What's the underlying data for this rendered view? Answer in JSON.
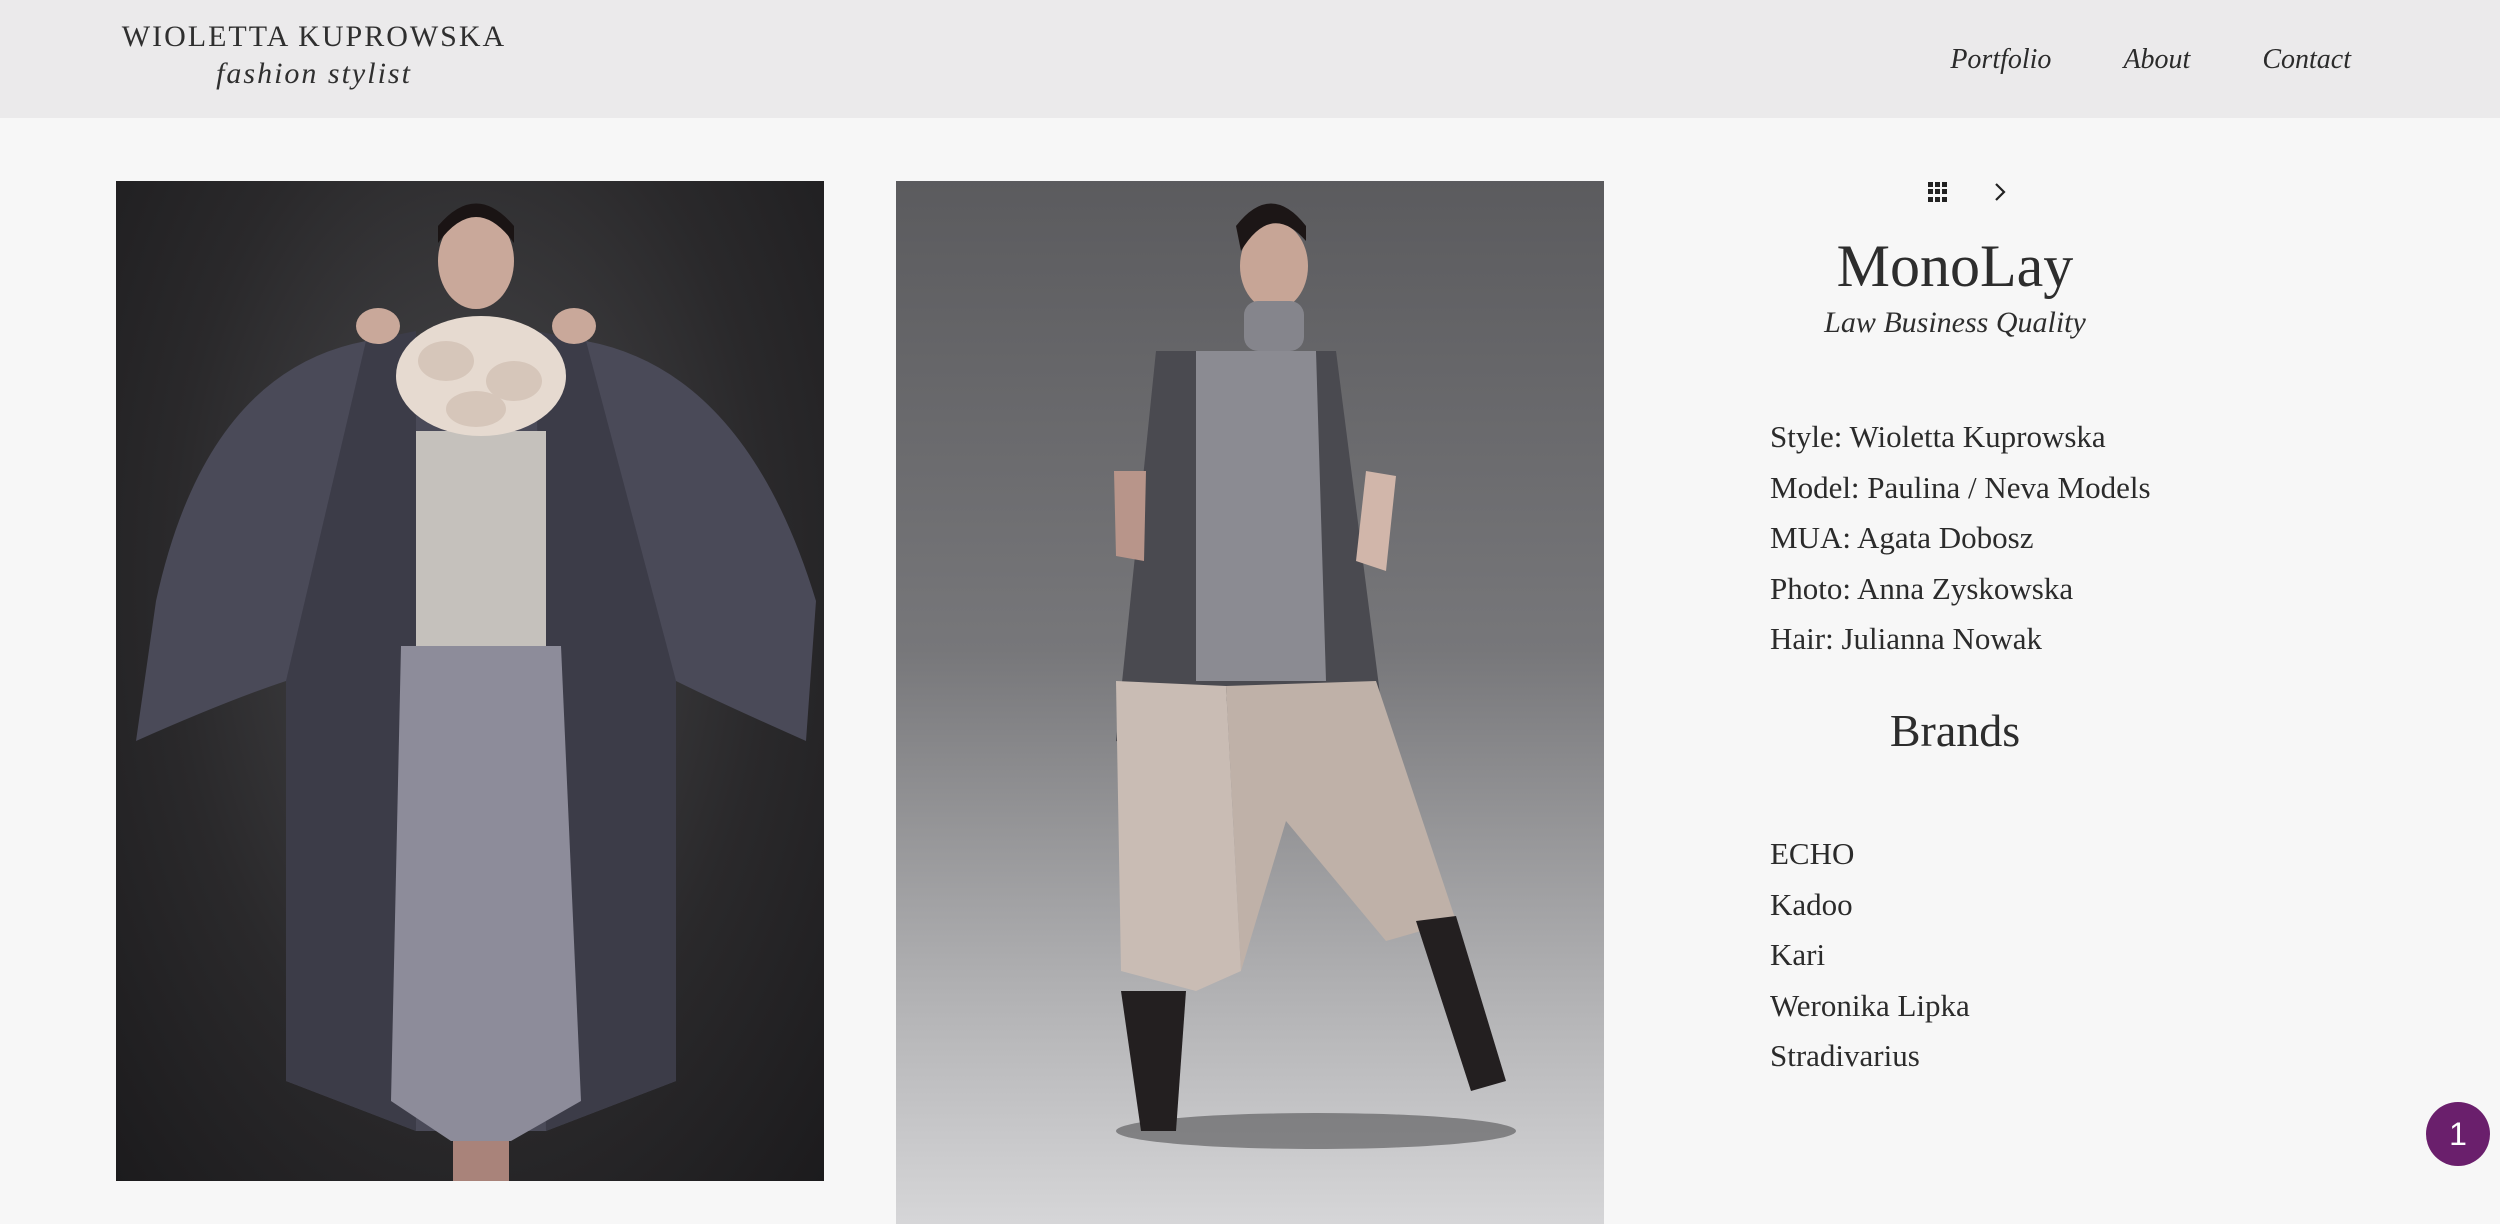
{
  "header": {
    "logo_name": "WIOLETTA KUPROWSKA",
    "logo_sub": "fashion stylist",
    "nav": [
      "Portfolio",
      "About",
      "Contact"
    ]
  },
  "icons": {
    "gallery": "grid-icon",
    "next": "chevron-right-icon"
  },
  "project": {
    "title": "MonoLay",
    "subtitle": "Law Business Quality",
    "credits": [
      "Style: Wioletta Kuprowska",
      "Model: Paulina / Neva Models",
      "MUA: Agata Dobosz",
      "Photo: Anna Zyskowska",
      "Hair: Julianna Nowak"
    ],
    "brands_heading": "Brands",
    "brands": [
      "ECHO",
      "Kadoo",
      "Kari",
      "Weronika Lipka",
      "Stradivarius"
    ]
  },
  "badge": {
    "count": "1",
    "color": "#6a1f6c"
  },
  "colors": {
    "header_bg": "#ebeaeb",
    "page_bg": "#f7f7f7",
    "text": "#2b2b2b"
  }
}
